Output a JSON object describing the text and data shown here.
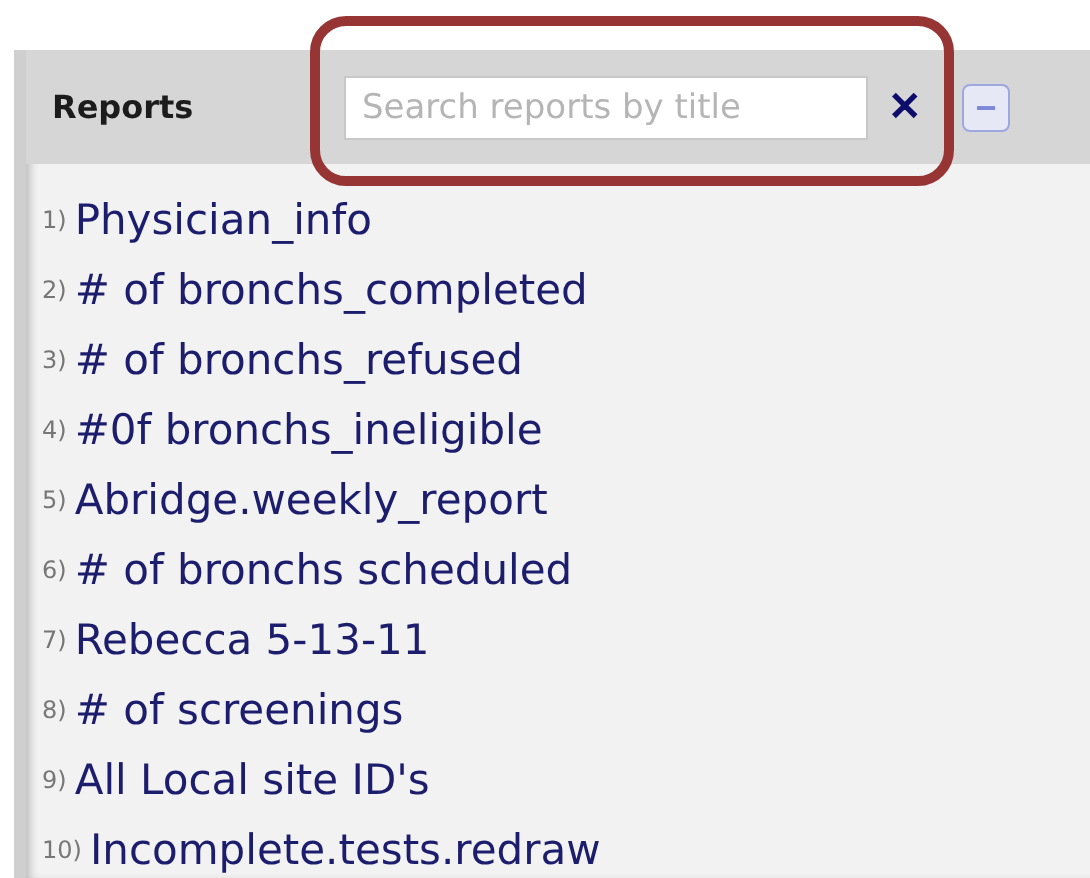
{
  "panel": {
    "title": "Reports",
    "search": {
      "placeholder": "Search reports by title"
    },
    "clear_label": "✕",
    "collapse_label": "−"
  },
  "reports": [
    {
      "number": "1)",
      "title": "Physician_info"
    },
    {
      "number": "2)",
      "title": "# of bronchs_completed"
    },
    {
      "number": "3)",
      "title": "# of bronchs_refused"
    },
    {
      "number": "4)",
      "title": "#0f bronchs_ineligible"
    },
    {
      "number": "5)",
      "title": "Abridge.weekly_report"
    },
    {
      "number": "6)",
      "title": "# of bronchs scheduled"
    },
    {
      "number": "7)",
      "title": "Rebecca 5-13-11"
    },
    {
      "number": "8)",
      "title": "# of screenings"
    },
    {
      "number": "9)",
      "title": "All Local site ID's"
    },
    {
      "number": "10)",
      "title": "Incomplete.tests.redraw"
    }
  ]
}
